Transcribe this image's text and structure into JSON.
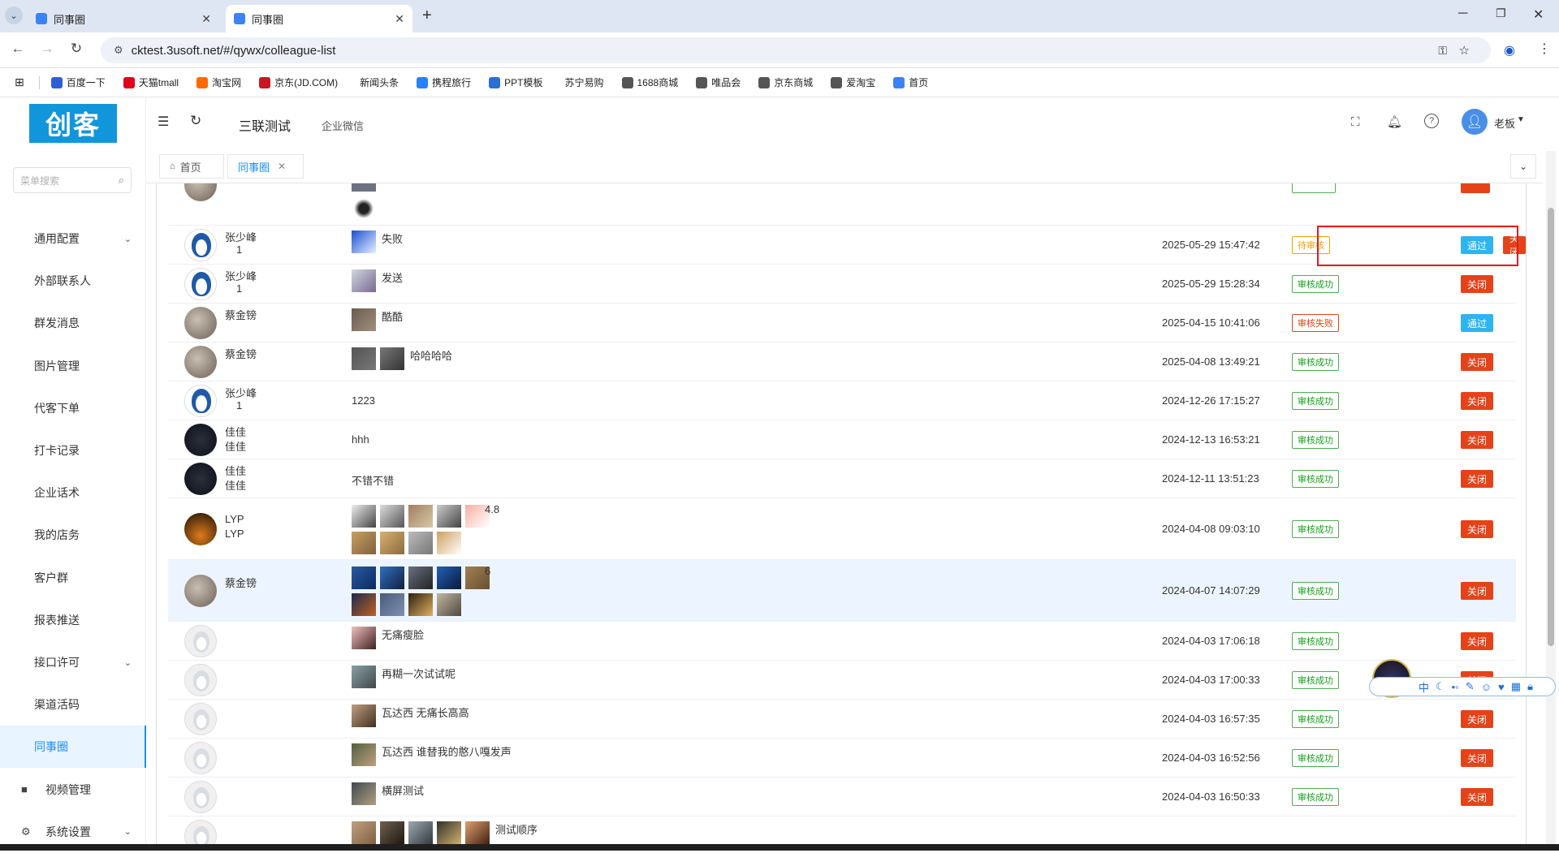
{
  "browser": {
    "tabs": [
      {
        "label": "同事圈",
        "active": false
      },
      {
        "label": "同事圈",
        "active": true
      }
    ],
    "url": "cktest.3usoft.net/#/qywx/colleague-list",
    "bookmarks": [
      {
        "label": "百度一下",
        "color": "#2f5fd6"
      },
      {
        "label": "天猫tmall",
        "color": "#e3001b"
      },
      {
        "label": "淘宝网",
        "color": "#ff6a00"
      },
      {
        "label": "京东(JD.COM)",
        "color": "#c91623"
      },
      {
        "label": "新闻头条",
        "color": "#ffffff"
      },
      {
        "label": "携程旅行",
        "color": "#2681ff"
      },
      {
        "label": "PPT模板",
        "color": "#2a6fd6"
      },
      {
        "label": "苏宁易购",
        "color": "#ffffff"
      },
      {
        "label": "1688商城",
        "color": "#555555"
      },
      {
        "label": "唯品会",
        "color": "#555555"
      },
      {
        "label": "京东商城",
        "color": "#555555"
      },
      {
        "label": "爱淘宝",
        "color": "#555555"
      },
      {
        "label": "首页",
        "color": "#3b82f6"
      }
    ]
  },
  "app": {
    "logo": "创客",
    "search_placeholder": "菜单搜索",
    "topbar": {
      "title": "三联测试",
      "subtitle": "企业微信",
      "user": "老板"
    },
    "tags": [
      {
        "label": "首页",
        "active": false
      },
      {
        "label": "同事圈",
        "active": true
      }
    ],
    "menu": [
      {
        "label": "通用配置",
        "chevron": true
      },
      {
        "label": "外部联系人"
      },
      {
        "label": "群发消息"
      },
      {
        "label": "图片管理"
      },
      {
        "label": "代客下单"
      },
      {
        "label": "打卡记录"
      },
      {
        "label": "企业话术"
      },
      {
        "label": "我的店务"
      },
      {
        "label": "客户群"
      },
      {
        "label": "报表推送"
      },
      {
        "label": "接口许可",
        "chevron": true
      },
      {
        "label": "渠道活码"
      },
      {
        "label": "同事圈",
        "active": true
      },
      {
        "label": "视频管理",
        "icon": "video-icon"
      },
      {
        "label": "系统设置",
        "chevron": true,
        "icon": "gear-icon"
      }
    ]
  },
  "rows": [
    {
      "user": "张少峰",
      "user2": "1",
      "avatar": "penguin",
      "content": "失败",
      "time": "2025-05-29 15:47:42",
      "status": "待审核",
      "status_type": "pending",
      "buttons": [
        "通过",
        "关闭"
      ]
    },
    {
      "user": "张少峰",
      "user2": "1",
      "avatar": "penguin",
      "content": "发送",
      "time": "2025-05-29 15:28:34",
      "status": "审核成功",
      "status_type": "ok",
      "buttons": [
        "关闭"
      ]
    },
    {
      "user": "蔡金镑",
      "user2": "",
      "avatar": "gray",
      "content": "酷酷",
      "time": "2025-04-15 10:41:06",
      "status": "审核失败",
      "status_type": "fail",
      "buttons": [
        "通过"
      ]
    },
    {
      "user": "蔡金镑",
      "user2": "",
      "avatar": "gray",
      "content": "哈哈哈哈",
      "time": "2025-04-08 13:49:21",
      "status": "审核成功",
      "status_type": "ok",
      "buttons": [
        "关闭"
      ]
    },
    {
      "user": "张少峰",
      "user2": "1",
      "avatar": "penguin",
      "content": "1223",
      "time": "2024-12-26 17:15:27",
      "status": "审核成功",
      "status_type": "ok",
      "buttons": [
        "关闭"
      ]
    },
    {
      "user": "佳佳",
      "user2": "佳佳",
      "avatar": "dark",
      "content": "hhh",
      "time": "2024-12-13 16:53:21",
      "status": "审核成功",
      "status_type": "ok",
      "buttons": [
        "关闭"
      ]
    },
    {
      "user": "佳佳",
      "user2": "佳佳",
      "avatar": "dark",
      "content": "不错不错",
      "time": "2024-12-11 13:51:23",
      "status": "审核成功",
      "status_type": "ok",
      "buttons": [
        "关闭"
      ]
    },
    {
      "user": "LYP",
      "user2": "LYP",
      "avatar": "lyp",
      "content": "4.8",
      "time": "2024-04-08 09:03:10",
      "status": "审核成功",
      "status_type": "ok",
      "buttons": [
        "关闭"
      ]
    },
    {
      "user": "蔡金镑",
      "user2": "",
      "avatar": "gray",
      "content": "6",
      "time": "2024-04-07 14:07:29",
      "status": "审核成功",
      "status_type": "ok",
      "buttons": [
        "关闭"
      ]
    },
    {
      "user": "",
      "user2": "",
      "avatar": "light",
      "content": "无痛瘦脸",
      "time": "2024-04-03 17:06:18",
      "status": "审核成功",
      "status_type": "ok",
      "buttons": [
        "关闭"
      ]
    },
    {
      "user": "",
      "user2": "",
      "avatar": "light",
      "content": "再糊一次试试呢",
      "time": "2024-04-03 17:00:33",
      "status": "审核成功",
      "status_type": "ok",
      "buttons": [
        "关闭"
      ]
    },
    {
      "user": "",
      "user2": "",
      "avatar": "light",
      "content": "瓦达西 无痛长高高",
      "time": "2024-04-03 16:57:35",
      "status": "审核成功",
      "status_type": "ok",
      "buttons": [
        "关闭"
      ]
    },
    {
      "user": "",
      "user2": "",
      "avatar": "light",
      "content": "瓦达西 谁替我的憨八嘎发声",
      "time": "2024-04-03 16:52:56",
      "status": "审核成功",
      "status_type": "ok",
      "buttons": [
        "关闭"
      ]
    },
    {
      "user": "",
      "user2": "",
      "avatar": "light",
      "content": "横屏测试",
      "time": "2024-04-03 16:50:33",
      "status": "审核成功",
      "status_type": "ok",
      "buttons": [
        "关闭"
      ]
    },
    {
      "user": "",
      "user2": "",
      "avatar": "light",
      "content": "测试顺序",
      "time": "",
      "status": "",
      "status_type": "ok",
      "buttons": []
    }
  ],
  "ime": {
    "label": "中"
  }
}
